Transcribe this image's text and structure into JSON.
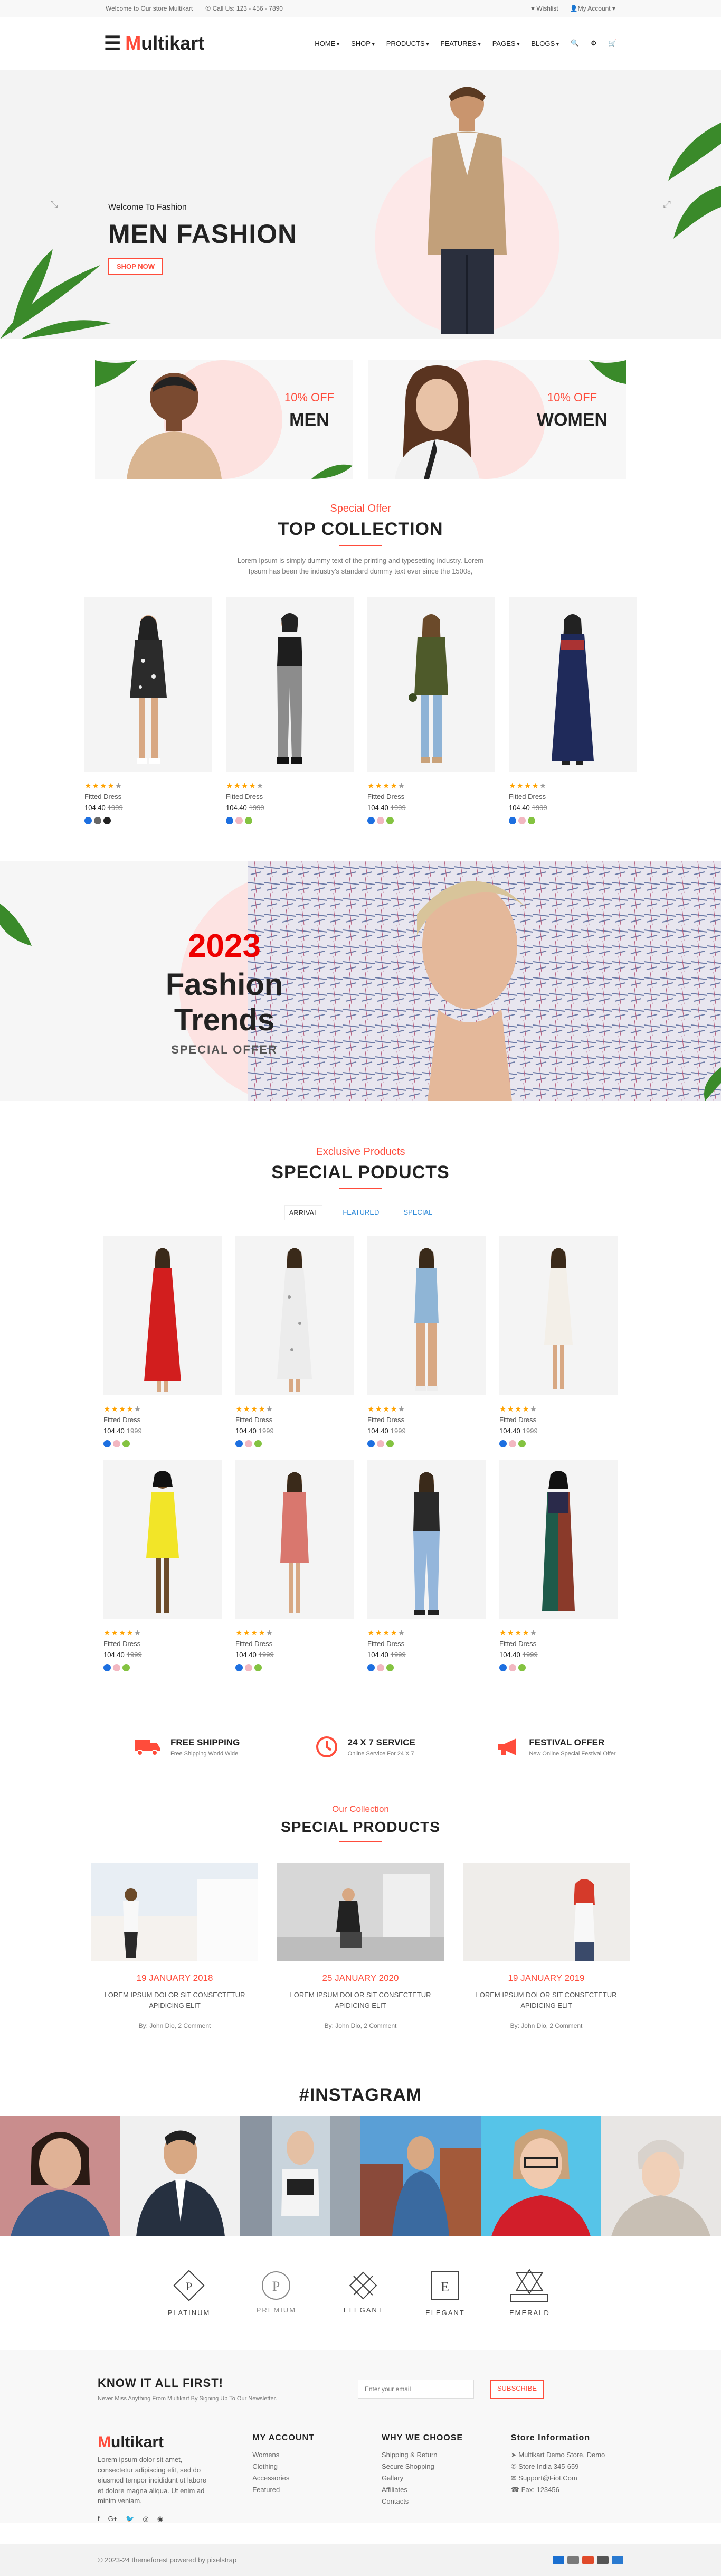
{
  "topbar": {
    "welcome": "Welcome to Our store Multikart",
    "phone": "Call Us: 123 - 456 - 7890",
    "wishlist": "Wishlist",
    "account": "My Account"
  },
  "header": {
    "logo_m": "M",
    "logo_rest": "ultikart",
    "nav": [
      "HOME",
      "SHOP",
      "PRODUCTS",
      "FEATURES",
      "PAGES",
      "BLOGS"
    ]
  },
  "hero": {
    "welcome": "Welcome To Fashion",
    "title": "MEN FASHION",
    "button": "SHOP NOW"
  },
  "banners": [
    {
      "offer": "10% OFF",
      "name": "MEN"
    },
    {
      "offer": "10% OFF",
      "name": "WOMEN"
    }
  ],
  "top_collection": {
    "sub": "Special Offer",
    "title": "TOP COLLECTION",
    "desc": "Lorem Ipsum is simply dummy text of the printing and typesetting industry. Lorem Ipsum has been the industry's standard dummy text ever since the 1500s,"
  },
  "product": {
    "name": "Fitted Dress",
    "price": "104.40",
    "old_price": "1999",
    "stars_filled": 4,
    "stars_total": 5
  },
  "parallax": {
    "year": "2023",
    "title": "Fashion Trends",
    "sub": "SPECIAL OFFER"
  },
  "special": {
    "sub": "Exclusive Products",
    "title": "SPECIAL PODUCTS",
    "tabs": [
      "ARRIVAL",
      "FEATURED",
      "SPECIAL"
    ]
  },
  "services": [
    {
      "title": "FREE SHIPPING",
      "desc": "Free Shipping World Wide"
    },
    {
      "title": "24 X 7 SERVICE",
      "desc": "Online Service For 24 X 7"
    },
    {
      "title": "FESTIVAL OFFER",
      "desc": "New Online Special Festival Offer"
    }
  ],
  "blog": {
    "sub": "Our Collection",
    "title": "SPECIAL PRODUCTS",
    "text": "LOREM IPSUM DOLOR SIT CONSECTETUR APIDICING ELIT",
    "by": "By: John Dio, 2 Comment",
    "dates": [
      "19 JANUARY 2018",
      "25 JANUARY 2020",
      "19 JANUARY 2019"
    ]
  },
  "instagram": {
    "title": "#INSTAGRAM"
  },
  "brands": [
    "PLATINUM",
    "PREMIUM",
    "ELEGANT",
    "ELEGANT",
    "EMERALD"
  ],
  "footer": {
    "sub_title": "KNOW IT ALL FIRST!",
    "sub_desc": "Never Miss Anything From Multikart By Signing Up To Our Newsletter.",
    "email_placeholder": "Enter your email",
    "subscribe": "SUBSCRIBE",
    "about": "Lorem ipsum dolor sit amet, consectetur adipiscing elit, sed do eiusmod tempor incididunt ut labore et dolore magna aliqua. Ut enim ad minim veniam.",
    "account_title": "MY ACCOUNT",
    "account_items": [
      "Womens",
      "Clothing",
      "Accessories",
      "Featured"
    ],
    "why_title": "WHY WE CHOOSE",
    "why_items": [
      "Shipping & Return",
      "Secure Shopping",
      "Gallary",
      "Affiliates",
      "Contacts"
    ],
    "store_title": "Store Information",
    "store_items": [
      "Multikart Demo Store, Demo",
      "Store India 345-659",
      "Support@Fiot.Com",
      "Fax: 123456"
    ],
    "copyright": "© 2023-24 themeforest powered by pixelstrap"
  },
  "colors": {
    "accent": "#ff4c3b",
    "star": "#ffa200"
  }
}
